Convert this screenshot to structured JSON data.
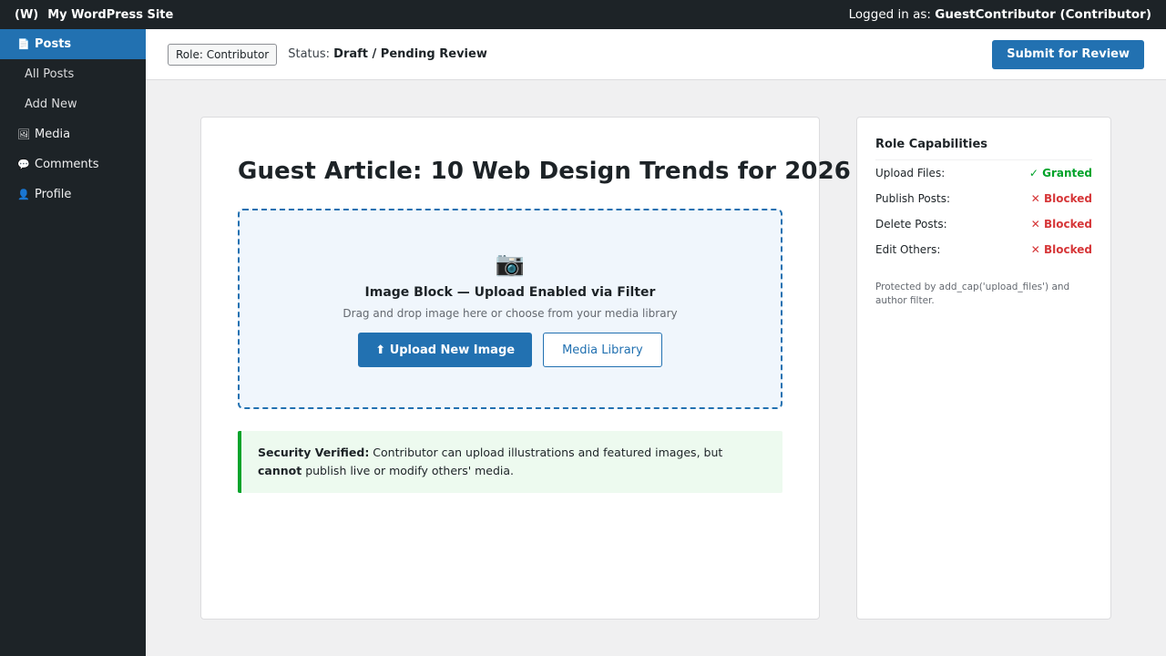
{
  "adminbar": {
    "logo": "(W)",
    "site_name": "My WordPress Site",
    "logged_in_prefix": "Logged in as: ",
    "user": "GuestContributor (Contributor)"
  },
  "sidebar": {
    "items": [
      {
        "label": "Posts",
        "icon": "📄"
      },
      {
        "label": "All Posts"
      },
      {
        "label": "Add New"
      },
      {
        "label": "Media",
        "icon": "🖼"
      },
      {
        "label": "Comments",
        "icon": "💬"
      },
      {
        "label": "Profile",
        "icon": "👤"
      }
    ]
  },
  "toolbar": {
    "role_badge": "Role: Contributor",
    "status_prefix": "Status: ",
    "status_value": "Draft / Pending Review",
    "submit_label": "Submit for Review"
  },
  "editor": {
    "title": "Guest Article: 10 Web Design Trends for 2026",
    "image_block": {
      "icon": "📷",
      "title": "Image Block — Upload Enabled via Filter",
      "subtitle": "Drag and drop image here or choose from your media library",
      "upload_label": "⬆ Upload New Image",
      "library_label": "Media Library"
    },
    "notice": {
      "strong": "Security Verified:",
      "text1": " Contributor can upload illustrations and featured images, but ",
      "strong2": "cannot",
      "text2": " publish live or modify others' media."
    }
  },
  "capabilities": {
    "title": "Role Capabilities",
    "rows": [
      {
        "label": "Upload Files:",
        "value": "✓ Granted"
      },
      {
        "label": "Publish Posts:",
        "value": "✕ Blocked"
      },
      {
        "label": "Delete Posts:",
        "value": "✕ Blocked"
      },
      {
        "label": "Edit Others:",
        "value": "✕ Blocked"
      }
    ],
    "note": "Protected by add_cap('upload_files') and author filter."
  },
  "colors": {
    "primary": "#2271b1",
    "adminbar": "#1d2327",
    "granted": "#00a32a",
    "blocked": "#d63638"
  }
}
